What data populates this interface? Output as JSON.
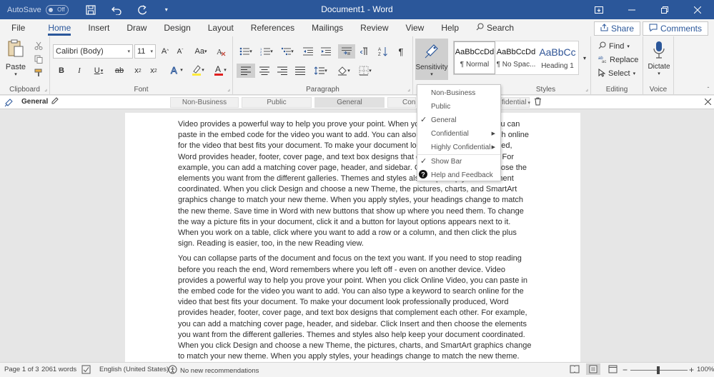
{
  "titlebar": {
    "autosave_label": "AutoSave",
    "autosave_state": "Off",
    "title": "Document1 - Word"
  },
  "tabs": [
    {
      "label": "File"
    },
    {
      "label": "Home"
    },
    {
      "label": "Insert"
    },
    {
      "label": "Draw"
    },
    {
      "label": "Design"
    },
    {
      "label": "Layout"
    },
    {
      "label": "References"
    },
    {
      "label": "Mailings"
    },
    {
      "label": "Review"
    },
    {
      "label": "View"
    },
    {
      "label": "Help"
    }
  ],
  "tab_search_label": "Search",
  "share_label": "Share",
  "comments_label": "Comments",
  "ribbon": {
    "clipboard": {
      "label": "Clipboard",
      "paste": "Paste"
    },
    "font": {
      "label": "Font",
      "font_name": "Calibri (Body)",
      "font_size": "11",
      "case": "Aa"
    },
    "paragraph": {
      "label": "Paragraph"
    },
    "sensitivity": {
      "label": "Sensitivity"
    },
    "styles": {
      "label": "Styles",
      "items": [
        {
          "sample": "AaBbCcDd",
          "name": "¶ Normal"
        },
        {
          "sample": "AaBbCcDd",
          "name": "¶ No Spac..."
        },
        {
          "sample": "AaBbCc",
          "name": "Heading 1"
        }
      ]
    },
    "editing": {
      "label": "Editing",
      "find": "Find",
      "replace": "Replace",
      "select": "Select"
    },
    "voice": {
      "label": "Voice",
      "dictate": "Dictate"
    }
  },
  "sensbar": {
    "label": "General",
    "segments": [
      "Non-Business",
      "Public",
      "General",
      "Con",
      "fidential"
    ]
  },
  "sens_menu": {
    "items": [
      "Non-Business",
      "Public",
      "General",
      "Confidential",
      "Highly Confidential",
      "Show Bar",
      "Help and Feedback"
    ]
  },
  "doc": {
    "p1": "Video provides a powerful way to help you prove your point. When you click Online Video, you can paste in the embed code for the video you want to add. You can also type a keyword to search online for the video that best fits your document. To make your document look professionally produced, Word provides header, footer, cover page, and text box designs that complement each other. For example, you can add a matching cover page, header, and sidebar. Click Insert and then choose the elements you want from the different galleries. Themes and styles also help keep your document coordinated. When you click Design and choose a new Theme, the pictures, charts, and SmartArt graphics change to match your new theme. When you apply styles, your headings change to match the new theme. Save time in Word with new buttons that show up where you need them. To change the way a picture fits in your document, click it and a button for layout options appears next to it. When you work on a table, click where you want to add a row or a column, and then click the plus sign. Reading is easier, too, in the new Reading view.",
    "p2": "You can collapse parts of the document and focus on the text you want. If you need to stop reading before you reach the end, Word remembers where you left off - even on another device. Video provides a powerful way to help you prove your point. When you click Online Video, you can paste in the embed code for the video you want to add. You can also type a keyword to search online for the video that best fits your document. To make your document look professionally produced, Word provides header, footer, cover page, and text box designs that complement each other. For example, you can add a matching cover page, header, and sidebar. Click Insert and then choose the elements you want from the different galleries. Themes and styles also help keep your document coordinated. When you click Design and choose a new Theme, the pictures, charts, and SmartArt graphics change to match your new theme. When you apply styles, your headings change to match the new theme. Save time in Word with new"
  },
  "status": {
    "page": "Page 1 of 3",
    "words": "2061 words",
    "language": "English (United States)",
    "recommendations": "No new recommendations",
    "zoom": "100%"
  },
  "colors": {
    "accent": "#2b579a",
    "ribbon": "#f3f3f3",
    "canvas": "#e6e6e6"
  }
}
